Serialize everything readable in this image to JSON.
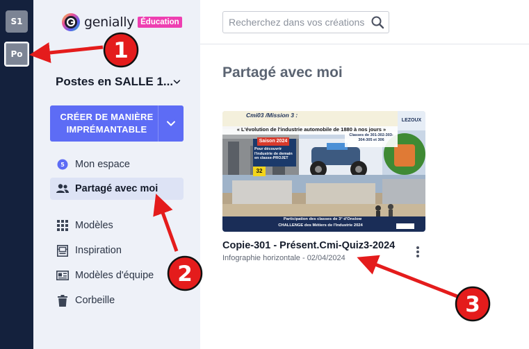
{
  "rail": {
    "workspaces": [
      {
        "label": "S1"
      },
      {
        "label": "Po"
      }
    ]
  },
  "sidebar": {
    "logo": {
      "wordmark": "genially",
      "badge": "Éducation"
    },
    "workspace_title": "Postes en SALLE 1...",
    "create_button": {
      "line1": "CRÉER DE MANIÈRE",
      "line2": "IMPRÉMANTABLE"
    },
    "nav": [
      {
        "label": "Mon espace",
        "icon": "space-icon"
      },
      {
        "label": "Partagé avec moi",
        "icon": "people-icon",
        "active": true
      },
      {
        "label": "Modèles",
        "icon": "grid-icon"
      },
      {
        "label": "Inspiration",
        "icon": "inspiration-icon"
      },
      {
        "label": "Modèles d'équipe",
        "icon": "team-templates-icon"
      },
      {
        "label": "Corbeille",
        "icon": "trash-icon"
      }
    ]
  },
  "main": {
    "search": {
      "placeholder": "Recherchez dans vos créations"
    },
    "page_title": "Partagé avec moi",
    "cards": [
      {
        "title": "Copie-301 - Présent.Cmi-Quiz3-2024",
        "subtitle": "Infographie horizontale - 02/04/2024",
        "thumbnail": {
          "mission": "Cmi03 /Mission 3 :",
          "headline": "« L'évolution de l'industrie automobile de 1880 à nos jours »",
          "classes": "Classes de 301-302-303-304-305 et 306",
          "saison": "Saison 2024",
          "discover": "Pour découvrir l'industrie de demain en classe-PROJET",
          "badge_number": "32",
          "college": "LEZOUX",
          "footer_line1": "Participation des classes de 3° d'Onslow",
          "footer_line2": "CHALLENGE des Métiers de l'Industrie 2024"
        }
      }
    ]
  },
  "annotations": [
    {
      "number": "1"
    },
    {
      "number": "2"
    },
    {
      "number": "3"
    }
  ],
  "colors": {
    "rail_bg": "#14213d",
    "sidebar_bg": "#eef1f8",
    "primary": "#5d6cf5",
    "badge_pink": "#ee3fb1",
    "annotation_red": "#e41c1c"
  }
}
